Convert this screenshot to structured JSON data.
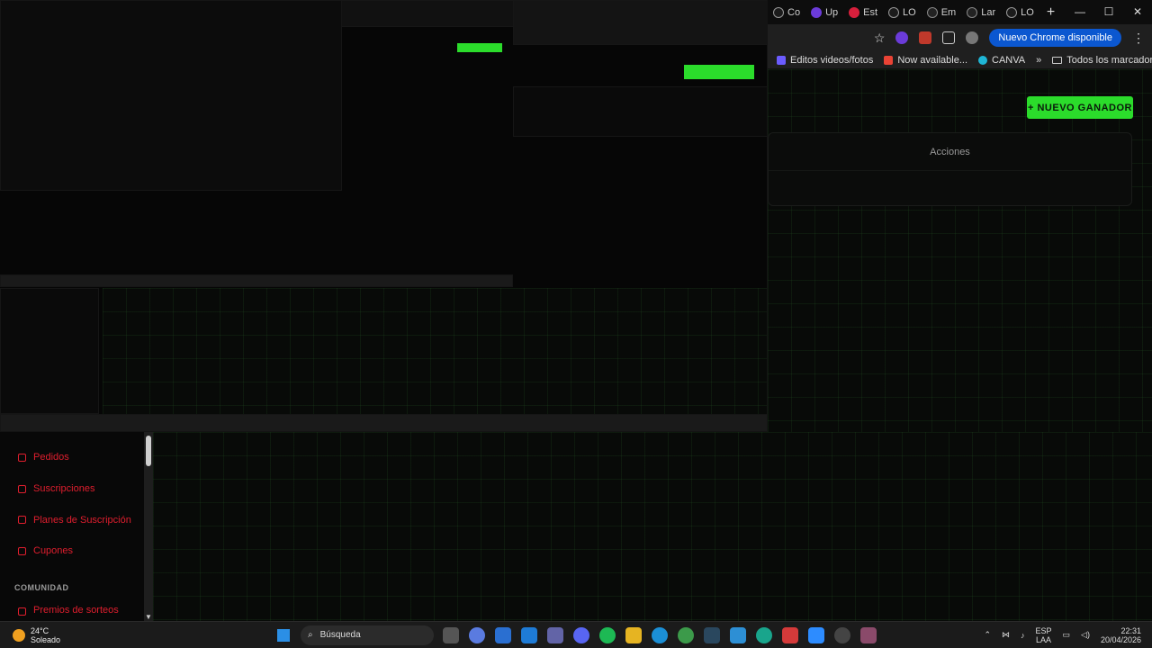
{
  "browser": {
    "tabs": [
      {
        "label": "Co",
        "favicon": "generic"
      },
      {
        "label": "Up",
        "favicon": "purple-circle"
      },
      {
        "label": "Est",
        "favicon": "red-circle"
      },
      {
        "label": "LO",
        "favicon": "verified"
      },
      {
        "label": "Em",
        "favicon": "tiktok"
      },
      {
        "label": "Lar",
        "favicon": "tiktok"
      },
      {
        "label": "LO",
        "favicon": "verified"
      }
    ],
    "new_tab_symbol": "+",
    "window_controls": {
      "minimize": "—",
      "maximize": "☐",
      "close": "✕"
    },
    "star_symbol": "☆",
    "update_button": "Nuevo Chrome disponible",
    "bookmarks": [
      {
        "label": "Editos videos/fotos",
        "color": "#6b5cff"
      },
      {
        "label": "Now available...",
        "color": "#ea4335"
      },
      {
        "label": "CANVA",
        "color": "#1fb6d6"
      }
    ],
    "bookmarks_more": "»",
    "all_bookmarks": "Todos los marcadores"
  },
  "main": {
    "new_button": "+ NUEVO GANADOR",
    "table_header": "Acciones",
    "accent": "#2bdc2b"
  },
  "sidebar": {
    "items": [
      {
        "label": "Pedidos"
      },
      {
        "label": "Suscripciones"
      },
      {
        "label": "Planes de Suscripción"
      },
      {
        "label": "Cupones"
      }
    ],
    "section_label": "COMUNIDAD",
    "partial_item": "Premios de sorteos",
    "item_color": "#e01e2e"
  },
  "taskbar": {
    "weather": {
      "temp": "24°C",
      "condition": "Soleado"
    },
    "search_placeholder": "Búsqueda",
    "tray": {
      "language": "ESP",
      "layout": "LAA",
      "time": "22:31",
      "date": "20/04/2026"
    }
  }
}
